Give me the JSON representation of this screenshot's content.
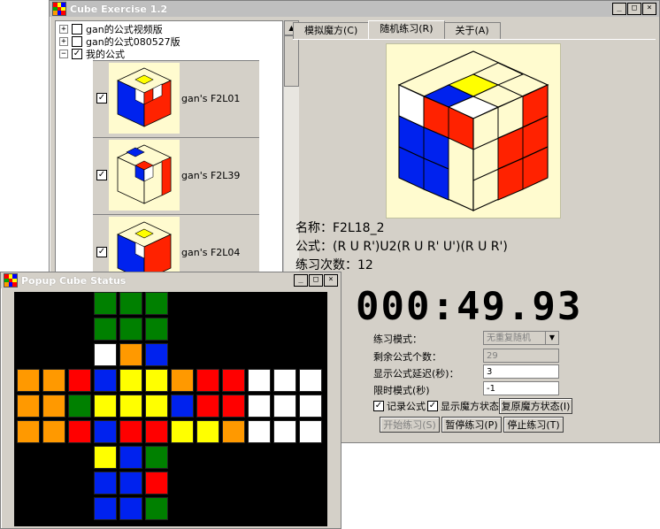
{
  "colors": {
    "W": "#ffffff",
    "Y": "#ffff00",
    "R": "#ff0000",
    "O": "#ff9900",
    "B": "#0022ee",
    "G": "#008000",
    "C": "#fffbcf"
  },
  "main_window": {
    "title": "Cube Exercise 1.2",
    "tree": {
      "items": [
        {
          "label": "gan的公式视频版",
          "expander": "+",
          "checked": false
        },
        {
          "label": "gan的公式080527版",
          "expander": "+",
          "checked": false
        },
        {
          "label": "我的公式",
          "expander": "−",
          "checked": true
        }
      ],
      "cards": [
        {
          "label": "gan's F2L01",
          "checked": true
        },
        {
          "label": "gan's F2L39",
          "checked": true
        },
        {
          "label": "gan's F2L04",
          "checked": true
        }
      ]
    },
    "tabs": [
      {
        "label": "模拟魔方(C)",
        "active": false
      },
      {
        "label": "随机练习(R)",
        "active": true
      },
      {
        "label": "关于(A)",
        "active": false
      }
    ],
    "info": {
      "name_line": "名称：F2L18_2",
      "formula_line": "公式：(R U R')U2(R U R' U')(R U R')",
      "count_line": "练习次数：12"
    },
    "timer": "000:49.93",
    "settings": {
      "mode_label": "练习模式：",
      "mode_value": "无重复随机",
      "remaining_label": "剩余公式个数：",
      "remaining_value": "29",
      "delay_label": "显示公式延迟(秒)：",
      "delay_value": "3",
      "limit_label": "限时模式(秒)",
      "limit_value": "-1"
    },
    "checkboxes": {
      "record_label": "记录公式",
      "show_state_label": "显示魔方状态"
    },
    "buttons": {
      "restore": "复原魔方状态(I)",
      "start": "开始练习(S)",
      "pause": "暂停练习(P)",
      "stop": "停止练习(T)"
    }
  },
  "popup": {
    "title": "Popup Cube Status",
    "faces": {
      "up": [
        "G",
        "G",
        "G",
        "G",
        "G",
        "G",
        "W",
        "O",
        "B"
      ],
      "left": [
        "O",
        "O",
        "R",
        "O",
        "O",
        "G",
        "O",
        "O",
        "R"
      ],
      "front": [
        "B",
        "Y",
        "Y",
        "Y",
        "Y",
        "Y",
        "B",
        "R",
        "R"
      ],
      "right": [
        "O",
        "R",
        "R",
        "B",
        "R",
        "R",
        "Y",
        "Y",
        "O"
      ],
      "back": [
        "W",
        "W",
        "W",
        "W",
        "W",
        "W",
        "W",
        "W",
        "W"
      ],
      "down": [
        "Y",
        "B",
        "G",
        "B",
        "B",
        "R",
        "B",
        "B",
        "G"
      ]
    }
  }
}
